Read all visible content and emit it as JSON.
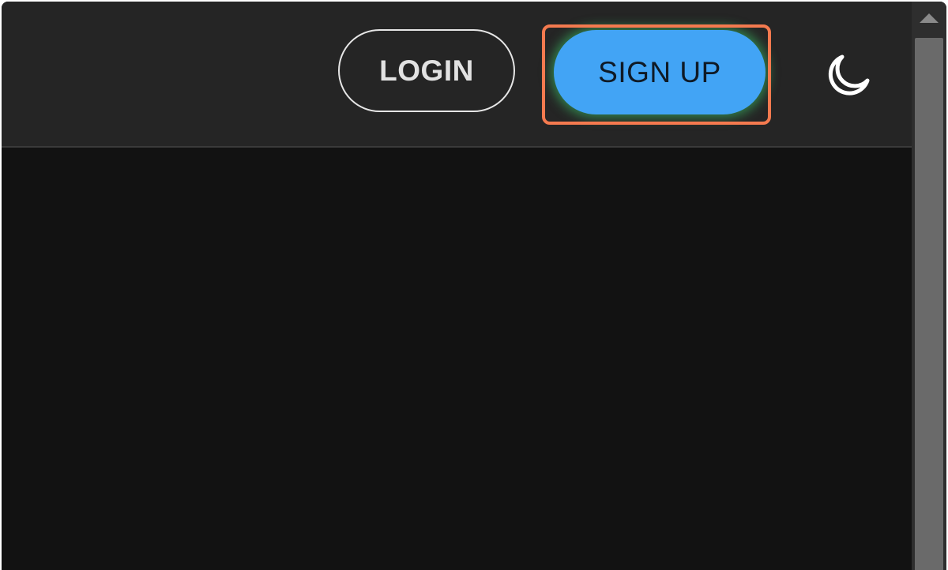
{
  "header": {
    "login_label": "LOGIN",
    "signup_label": "SIGN UP",
    "theme_toggle_icon": "moon-icon"
  },
  "colors": {
    "page_background": "#121212",
    "header_background": "#252525",
    "signup_background": "#42a4f5",
    "signup_glow": "#3cd26e",
    "highlight_border": "#f47a4f",
    "login_border": "#e6e6e6"
  },
  "scrollbar": {
    "up_arrow_icon": "scroll-up-arrow-icon"
  }
}
